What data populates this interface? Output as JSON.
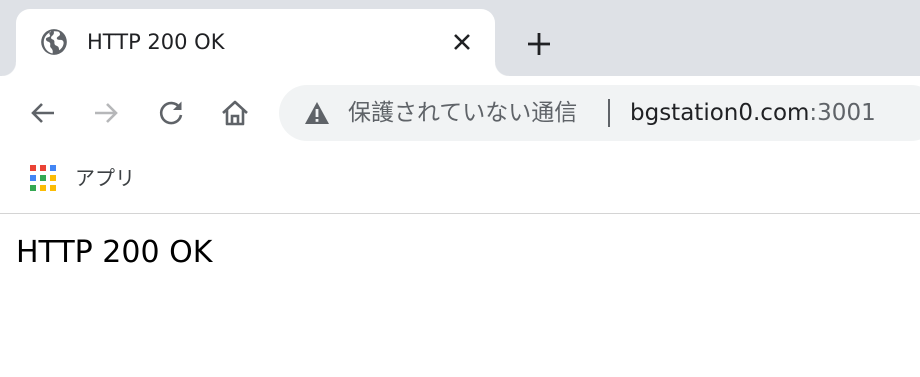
{
  "browser": {
    "tab": {
      "title": "HTTP 200 OK",
      "favicon": "globe-icon"
    },
    "omnibox": {
      "security_label": "保護されていない通信",
      "url_host": "bgstation0.com",
      "url_port": ":3001"
    },
    "bookmarks": {
      "apps_label": "アプリ"
    }
  },
  "page": {
    "body_text": "HTTP 200 OK"
  },
  "colors": {
    "tabstrip": "#dee1e6",
    "omnibox": "#f1f3f4",
    "icon": "#5f6368",
    "icon_disabled": "#b6b7b9",
    "text": "#202124"
  }
}
